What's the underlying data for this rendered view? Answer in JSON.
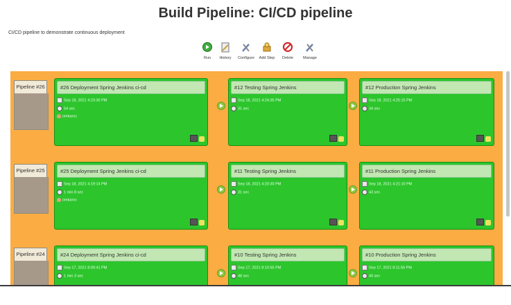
{
  "header": {
    "title": "Build Pipeline: CI/CD pipeline",
    "description": "CI/CD pipeline to demonstrate continuous deployment"
  },
  "toolbar": {
    "run": "Run",
    "history": "History",
    "configure": "Configure",
    "add_step": "Add Step",
    "delete": "Delete",
    "manage": "Manage"
  },
  "pipelines": [
    {
      "label": "Pipeline #26",
      "stages": [
        {
          "title": "#26 Deployment Spring Jenkins ci-cd",
          "date": "Sep 18, 2021 4:23:30 PM",
          "duration": "54 sec",
          "user": "omkaroc"
        },
        {
          "title": "#12 Testing Spring Jenkins",
          "date": "Sep 18, 2021 4:24:35 PM",
          "duration": "31 sec"
        },
        {
          "title": "#12 Production Spring Jenkins",
          "date": "Sep 18, 2021 4:25:15 PM",
          "duration": "34 sec"
        }
      ]
    },
    {
      "label": "Pipeline #25",
      "stages": [
        {
          "title": "#25 Deployment Spring Jenkins ci-cd",
          "date": "Sep 18, 2021 4:19:14 PM",
          "duration": "1 min 8 sec",
          "user": "omkaroc"
        },
        {
          "title": "#11 Testing Spring Jenkins",
          "date": "Sep 18, 2021 4:20:30 PM",
          "duration": "31 sec"
        },
        {
          "title": "#11 Production Spring Jenkins",
          "date": "Sep 18, 2021 4:21:10 PM",
          "duration": "43 sec"
        }
      ]
    },
    {
      "label": "Pipeline #24",
      "stages": [
        {
          "title": "#24 Deployment Spring Jenkins ci-cd",
          "date": "Sep 17, 2021 8:09:41 PM",
          "duration": "1 min 3 sec"
        },
        {
          "title": "#10 Testing Spring Jenkins",
          "date": "Sep 17, 2021 8:10:55 PM",
          "duration": "48 sec"
        },
        {
          "title": "#10 Production Spring Jenkins",
          "date": "Sep 17, 2021 8:11:56 PM",
          "duration": "40 sec"
        }
      ]
    }
  ],
  "colors": {
    "canvas_bg": "#fbac42",
    "stage_success": "#2cc52c",
    "stage_title_bg": "#c2e7b3",
    "run_block": "#a7998a"
  }
}
